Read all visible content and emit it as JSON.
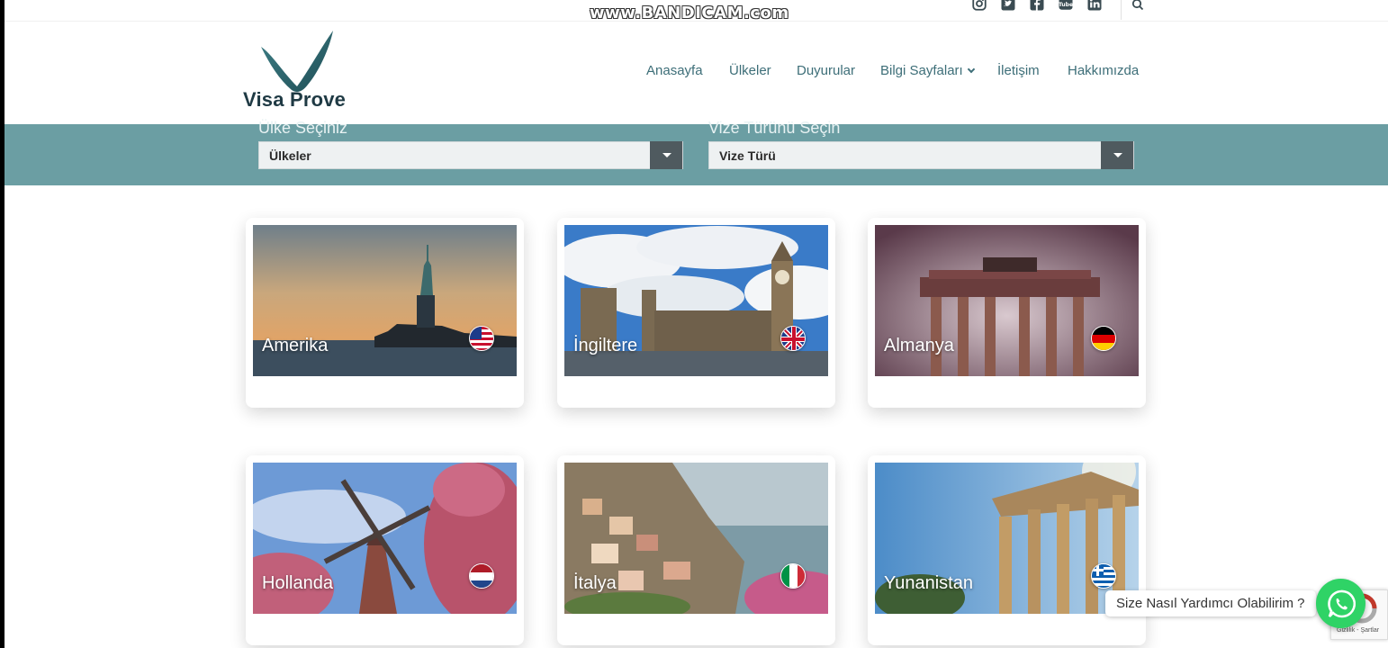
{
  "watermark": "www.BANDICAM.com",
  "social": [
    "instagram-icon",
    "twitter-icon",
    "facebook-icon",
    "youtube-icon",
    "linkedin-icon"
  ],
  "logo": {
    "text": "Visa Prove",
    "color": "#2c6b73"
  },
  "nav": {
    "items": [
      "Anasayfa",
      "Ülkeler",
      "Duyurular",
      "Bilgi Sayfaları",
      "İletişim",
      "Hakkımızda"
    ]
  },
  "search": {
    "country_label": "Ülke Seçiniz",
    "country_value": "Ülkeler",
    "visa_label": "Vize Türünü Seçin",
    "visa_value": "Vize Türü",
    "band_color": "#6b9ea3"
  },
  "countries": [
    {
      "name": "Amerika",
      "flag": "us-flag-icon"
    },
    {
      "name": "İngiltere",
      "flag": "uk-flag-icon"
    },
    {
      "name": "Almanya",
      "flag": "germany-flag-icon"
    },
    {
      "name": "Hollanda",
      "flag": "netherlands-flag-icon"
    },
    {
      "name": "İtalya",
      "flag": "italy-flag-icon"
    },
    {
      "name": "Yunanistan",
      "flag": "greece-flag-icon"
    }
  ],
  "chat": {
    "bubble": "Size Nasıl Yardımcı Olabilirim ?",
    "color": "#2fd366"
  },
  "recaptcha": {
    "text": "Gizlilik - Şartlar"
  }
}
